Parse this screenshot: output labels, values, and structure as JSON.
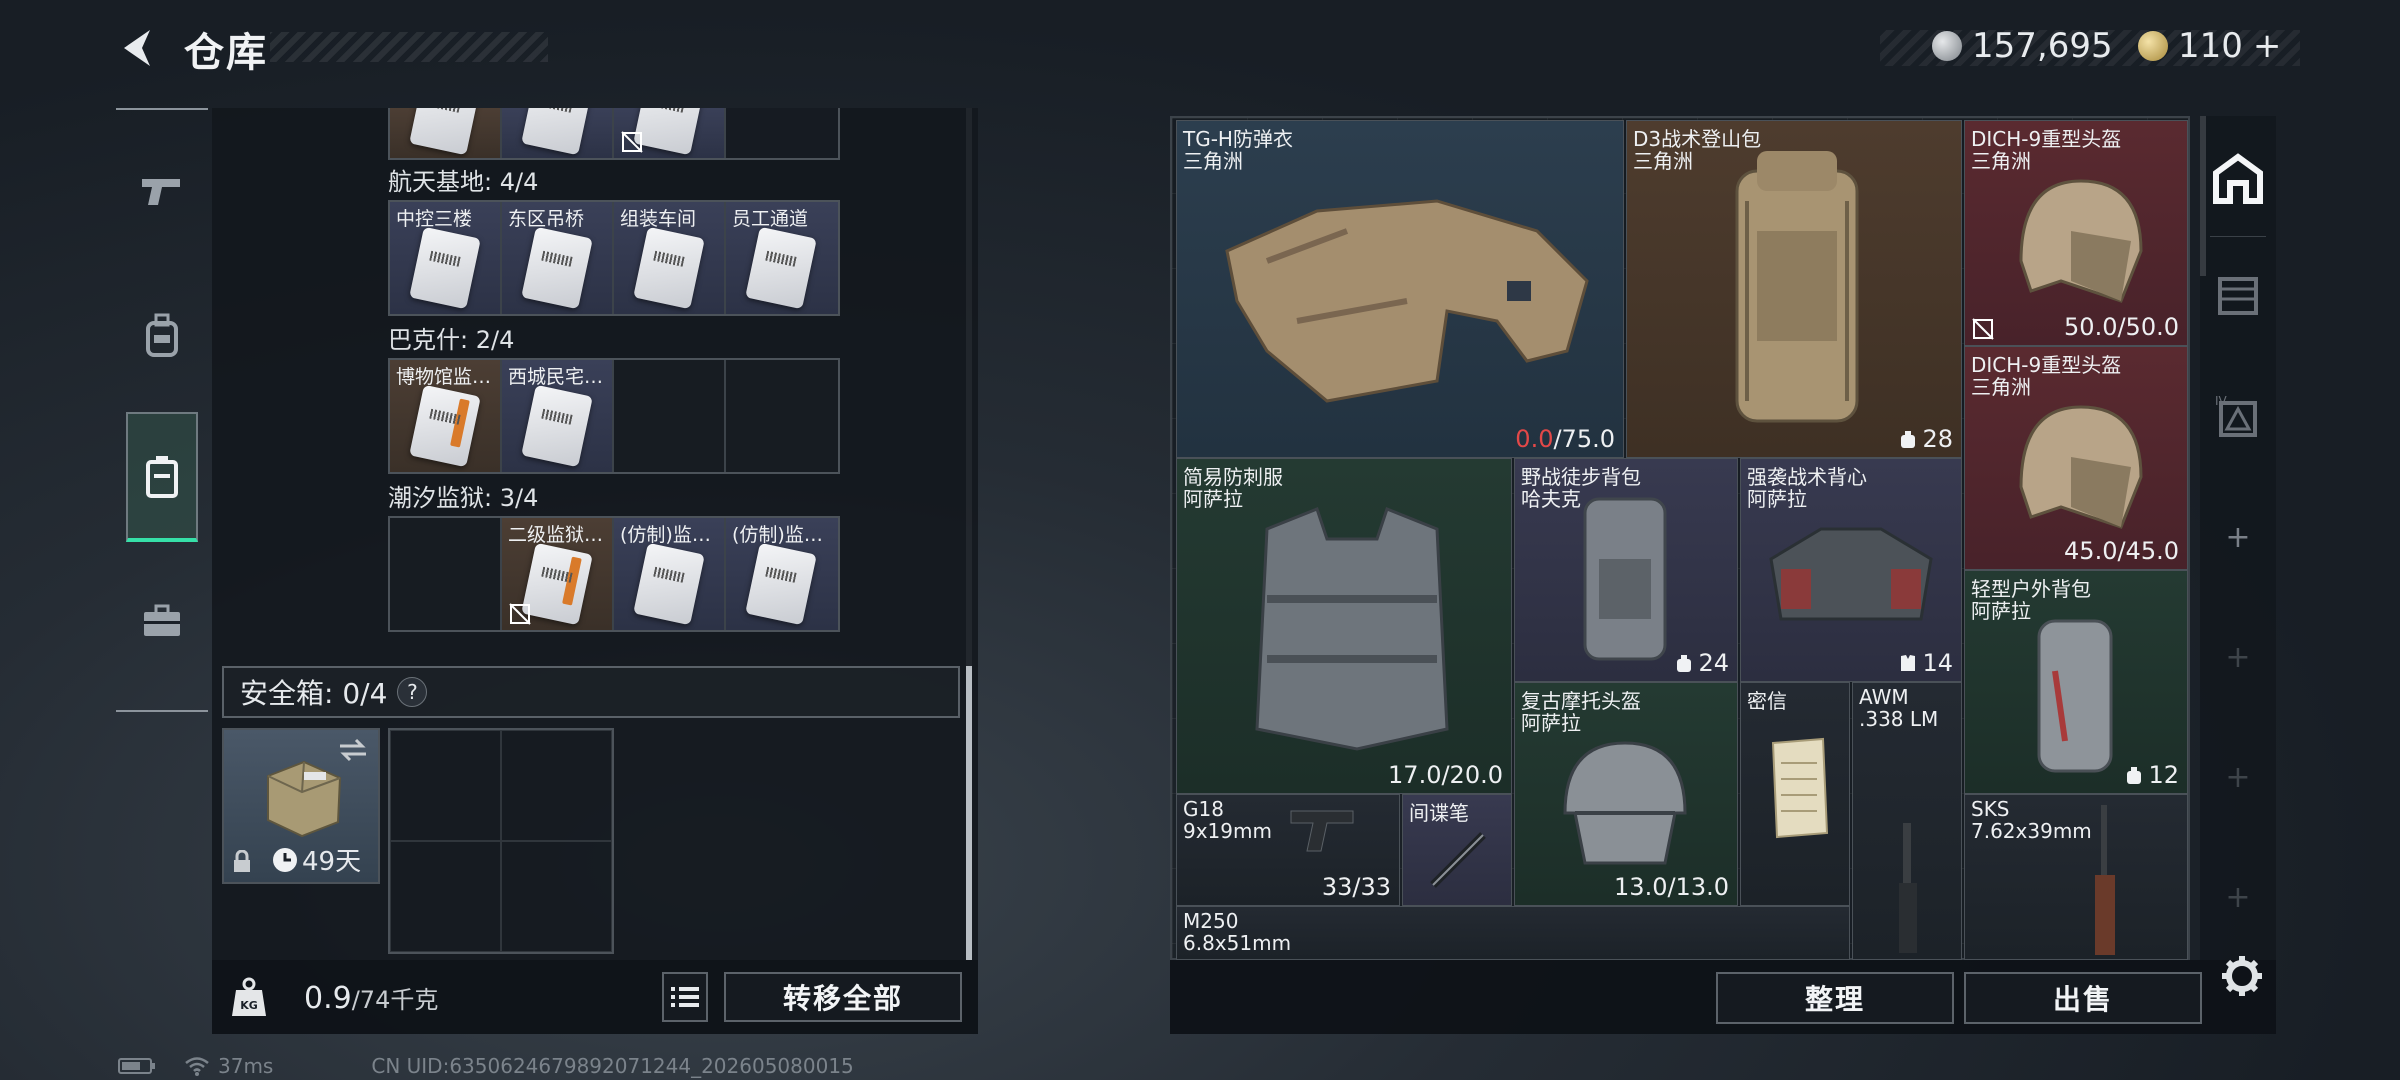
{
  "header": {
    "title": "仓库"
  },
  "currency": {
    "silver": "157,695",
    "gold": "110",
    "gold_add": "+"
  },
  "groups": [
    {
      "label": "航天基地: 4/4",
      "cells": [
        {
          "name": "中控三楼",
          "color": "blue"
        },
        {
          "name": "东区吊桥",
          "color": "blue"
        },
        {
          "name": "组装车间",
          "color": "blue"
        },
        {
          "name": "员工通道",
          "color": "blue"
        }
      ]
    },
    {
      "label": "巴克什: 2/4",
      "cells": [
        {
          "name": "博物馆监…",
          "color": "brown"
        },
        {
          "name": "西城民宅…",
          "color": "blue"
        },
        {
          "name": "",
          "color": "empty"
        },
        {
          "name": "",
          "color": "empty"
        }
      ]
    },
    {
      "label": "潮汐监狱: 3/4",
      "cells": [
        {
          "name": "",
          "color": "empty"
        },
        {
          "name": "二级监狱…",
          "color": "brown"
        },
        {
          "name": "(仿制)监…",
          "color": "blue"
        },
        {
          "name": "(仿制)监…",
          "color": "blue"
        }
      ]
    }
  ],
  "safe_box": {
    "label": "安全箱: 0/4",
    "help": "?",
    "days": "49天"
  },
  "weight": {
    "value": "0.9",
    "max": "/74千克"
  },
  "buttons": {
    "transfer_all": "转移全部",
    "sort": "整理",
    "sell": "出售"
  },
  "items": [
    {
      "name": "TG-H防弹衣",
      "sub": "三角洲",
      "dur_red": "0.0",
      "dur_rest": "/75.0"
    },
    {
      "name": "D3战术登山包",
      "sub": "三角洲",
      "cap": "28"
    },
    {
      "name": "DICH-9重型头盔",
      "sub": "三角洲",
      "dur": "50.0/50.0"
    },
    {
      "name": "DICH-9重型头盔",
      "sub": "三角洲",
      "dur": "45.0/45.0"
    },
    {
      "name": "简易防刺服",
      "sub": "阿萨拉",
      "dur": "17.0/20.0"
    },
    {
      "name": "野战徒步背包",
      "sub": "哈夫克",
      "cap": "24"
    },
    {
      "name": "强袭战术背心",
      "sub": "阿萨拉",
      "cap": "14"
    },
    {
      "name": "轻型户外背包",
      "sub": "阿萨拉",
      "cap": "12"
    },
    {
      "name": "复古摩托头盔",
      "sub": "阿萨拉",
      "dur": "13.0/13.0"
    },
    {
      "name": "密信",
      "sub": ""
    },
    {
      "name": "AWM",
      "sub": ".338 LM"
    },
    {
      "name": "G18",
      "sub": "9x19mm",
      "dur": "33/33"
    },
    {
      "name": "间谍笔",
      "sub": ""
    },
    {
      "name": "SKS",
      "sub": "7.62x39mm"
    },
    {
      "name": "M250",
      "sub": "6.8x51mm"
    }
  ],
  "status": {
    "ping": "37ms",
    "uid": "CN UID:6350624679892071244_202605080015"
  }
}
